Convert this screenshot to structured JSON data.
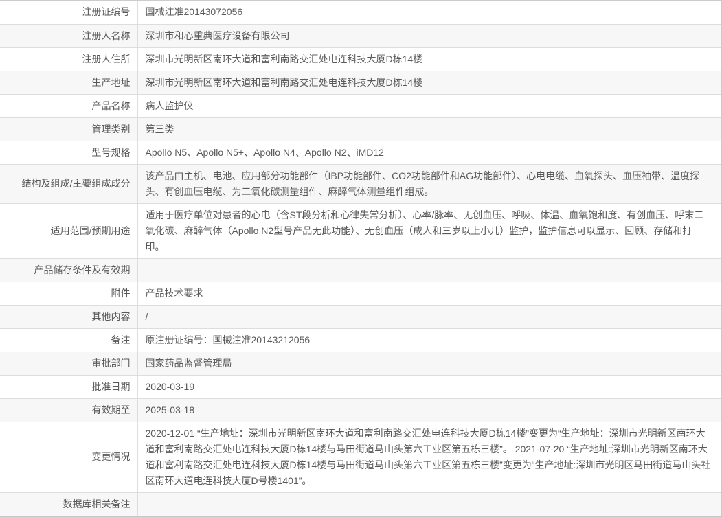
{
  "colors": {
    "row_stripe": "#f7f7f7",
    "row_border": "#dddddd",
    "text": "#595959",
    "outer_border": "#c8c9cc",
    "below_table_strip": "#e9eaed"
  },
  "table": {
    "rows": [
      {
        "label": "注册证编号",
        "value": "国械注准20143072056"
      },
      {
        "label": "注册人名称",
        "value": "深圳市和心重典医疗设备有限公司"
      },
      {
        "label": "注册人住所",
        "value": "深圳市光明新区南环大道和富利南路交汇处电连科技大厦D栋14楼"
      },
      {
        "label": "生产地址",
        "value": "深圳市光明新区南环大道和富利南路交汇处电连科技大厦D栋14楼"
      },
      {
        "label": "产品名称",
        "value": "病人监护仪"
      },
      {
        "label": "管理类别",
        "value": "第三类"
      },
      {
        "label": "型号规格",
        "value": "Apollo N5、Apollo N5+、Apollo N4、Apollo N2、iMD12"
      },
      {
        "label": "结构及组成/主要组成成分",
        "value": "该产品由主机、电池、应用部分功能部件（IBP功能部件、CO2功能部件和AG功能部件）、心电电缆、血氧探头、血压袖带、温度探头、有创血压电缆、为二氧化碳测量组件、麻醉气体测量组件组成。"
      },
      {
        "label": "适用范围/预期用途",
        "value": "适用于医疗单位对患者的心电（含ST段分析和心律失常分析）、心率/脉率、无创血压、呼吸、体温、血氧饱和度、有创血压、呼末二氧化碳、麻醉气体（Apollo N2型号产品无此功能）、无创血压（成人和三岁以上小儿）监护，监护信息可以显示、回顾、存储和打印。"
      },
      {
        "label": "产品储存条件及有效期",
        "value": ""
      },
      {
        "label": "附件",
        "value": "产品技术要求"
      },
      {
        "label": "其他内容",
        "value": "/"
      },
      {
        "label": "备注",
        "value": "原注册证编号：国械注准20143212056"
      },
      {
        "label": "审批部门",
        "value": "国家药品监督管理局"
      },
      {
        "label": "批准日期",
        "value": "2020-03-19"
      },
      {
        "label": "有效期至",
        "value": "2025-03-18"
      },
      {
        "label": "变更情况",
        "value": "2020-12-01 “生产地址：深圳市光明新区南环大道和富利南路交汇处电连科技大厦D栋14楼”变更为“生产地址：深圳市光明新区南环大道和富利南路交汇处电连科技大厦D栋14楼与马田街道马山头第六工业区第五栋三楼”。 2021-07-20 “生产地址:深圳市光明新区南环大道和富利南路交汇处电连科技大厦D栋14楼与马田街道马山头第六工业区第五栋三楼”变更为“生产地址:深圳市光明区马田街道马山头社区南环大道电连科技大厦D号楼1401”。"
      },
      {
        "label": "数据库相关备注",
        "value": ""
      }
    ]
  }
}
